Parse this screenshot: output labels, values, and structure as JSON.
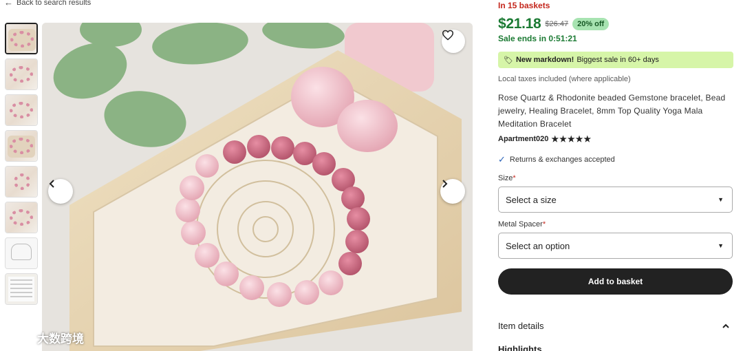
{
  "nav": {
    "back_label": "Back to search results",
    "back_icon": "arrow-left-icon"
  },
  "gallery": {
    "thumbnails": [
      {
        "kind": "bracelet-tray",
        "active": true
      },
      {
        "kind": "bracelet-pink"
      },
      {
        "kind": "bracelet-pink"
      },
      {
        "kind": "bracelet-tray"
      },
      {
        "kind": "bracelet-stones"
      },
      {
        "kind": "bracelet-pink"
      },
      {
        "kind": "hand-sizing-guide"
      },
      {
        "kind": "document"
      }
    ],
    "favorite_icon": "heart-icon",
    "prev_icon": "chevron-left-icon",
    "next_icon": "chevron-right-icon"
  },
  "watermark": {
    "text": "大数跨境"
  },
  "product": {
    "in_baskets": "In 15 baskets",
    "price": "$21.18",
    "original_price": "$26.47",
    "discount": "20% off",
    "sale_ends": "Sale ends in 0:51:21",
    "markdown": {
      "bold": "New markdown!",
      "rest": " Biggest sale in 60+ days"
    },
    "taxes": "Local taxes included (where applicable)",
    "title": "Rose Quartz & Rhodonite beaded Gemstone bracelet, Bead jewelry, Healing Bracelet, 8mm Top Quality Yoga Mala Meditation Bracelet",
    "shop_name": "Apartment020",
    "rating_stars": "★★★★★",
    "rating_value": 5,
    "returns": "Returns & exchanges accepted",
    "size_label": "Size",
    "size_placeholder": "Select a size",
    "spacer_label": "Metal Spacer",
    "spacer_placeholder": "Select an option",
    "required_mark": "*",
    "add_to_basket": "Add to basket",
    "item_details": "Item details",
    "highlights": "Highlights"
  },
  "colors": {
    "price_green": "#1b7a33",
    "alert_red": "#c4271d",
    "markdown_bg": "#d6f5a8",
    "discount_bg": "#a7e3b1",
    "button_dark": "#222222"
  }
}
